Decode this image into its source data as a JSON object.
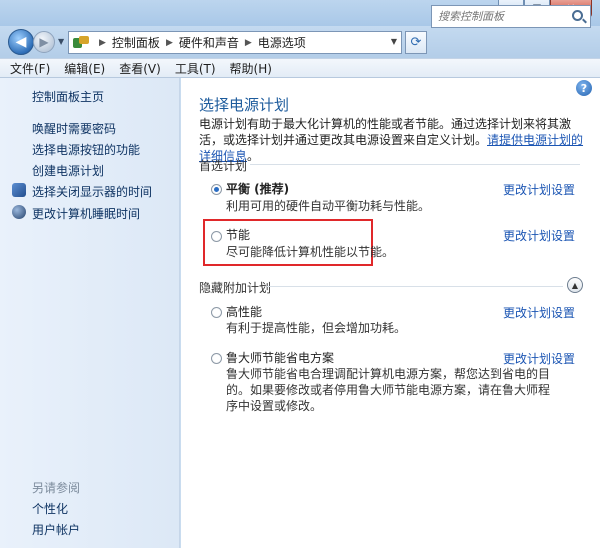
{
  "window": {
    "controls": {
      "minimize": "▁",
      "maximize": "□",
      "close": "✕"
    }
  },
  "address_bar": {
    "crumbs": [
      "控制面板",
      "硬件和声音",
      "电源选项"
    ],
    "search_placeholder": "搜索控制面板"
  },
  "menu": [
    "文件(F)",
    "编辑(E)",
    "查看(V)",
    "工具(T)",
    "帮助(H)"
  ],
  "sidebar": {
    "home": "控制面板主页",
    "links": [
      "唤醒时需要密码",
      "选择电源按钮的功能",
      "创建电源计划",
      "选择关闭显示器的时间",
      "更改计算机睡眠时间"
    ],
    "see_also_heading": "另请参阅",
    "see_also": [
      "个性化",
      "用户帐户"
    ]
  },
  "main": {
    "title": "选择电源计划",
    "description": "电源计划有助于最大化计算机的性能或者节能。通过选择计划来将其激活，或选择计划并通过更改其电源设置来自定义计划。",
    "description_link": "请提供电源计划的详细信息",
    "description_end": "。",
    "preferred_heading": "首选计划",
    "hidden_heading": "隐藏附加计划",
    "change_settings": "更改计划设置",
    "plans": [
      {
        "name": "平衡 (推荐)",
        "desc": "利用可用的硬件自动平衡功耗与性能。",
        "selected": true
      },
      {
        "name": "节能",
        "desc": "尽可能降低计算机性能以节能。",
        "selected": false
      },
      {
        "name": "高性能",
        "desc": "有利于提高性能，但会增加功耗。",
        "selected": false
      },
      {
        "name": "鲁大师节能省电方案",
        "desc": "鲁大师节能省电合理调配计算机电源方案，帮您达到省电的目的。如果要修改或者停用鲁大师节能电源方案，请在鲁大师程序中设置或修改。",
        "selected": false
      }
    ]
  },
  "colors": {
    "link": "#1b55b3",
    "title": "#1d5b9c",
    "highlight": "#e0282a"
  }
}
